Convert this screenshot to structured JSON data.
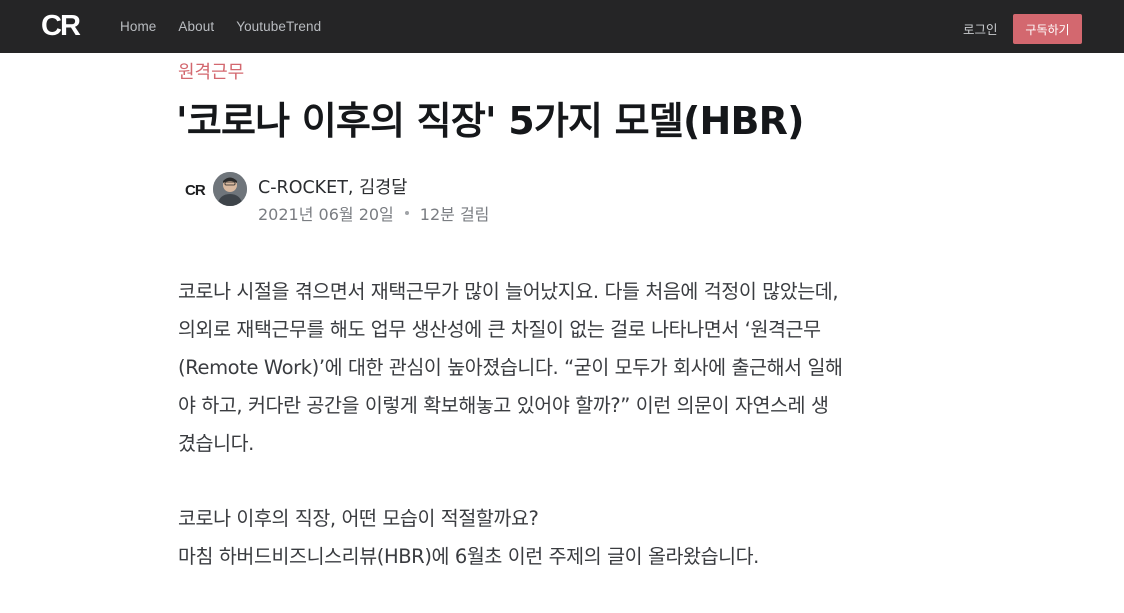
{
  "header": {
    "logo_text": "CR",
    "nav": [
      "Home",
      "About",
      "YoutubeTrend"
    ],
    "login_label": "로그인",
    "subscribe_label": "구독하기",
    "colors": {
      "bar": "#252526",
      "accent": "#d3686f"
    }
  },
  "article": {
    "tag": "원격근무",
    "title": "'코로나 이후의 직장' 5가지 모델(HBR)",
    "authors": [
      "C-ROCKET",
      "김경달"
    ],
    "author_separator": ", ",
    "date": "2021년 06월 20일",
    "read_time": "12분 걸림",
    "paragraph1": [
      "코로나 시절을 겪으면서 재택근무가 많이 늘어났지요. 다들 처음에 걱정이 많았는데,",
      "의외로 재택근무를 해도 업무 생산성에 큰 차질이 없는 걸로 나타나면서 ‘원격근무",
      "(Remote Work)’에 대한 관심이 높아졌습니다. “굳이 모두가 회사에 출근해서 일해",
      "야 하고, 커다란 공간을 이렇게 확보해놓고 있어야 할까?” 이런 의문이 자연스레 생",
      "겼습니다."
    ],
    "paragraph2": [
      "코로나 이후의 직장, 어떤 모습이 적절할까요?",
      "마침 하버드비즈니스리뷰(HBR)에 6월초 이런 주제의 글이 올라왔습니다."
    ]
  }
}
